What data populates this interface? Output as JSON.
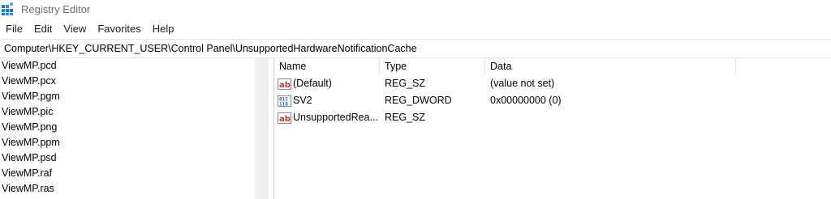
{
  "window": {
    "title": "Registry Editor"
  },
  "menu": [
    "File",
    "Edit",
    "View",
    "Favorites",
    "Help"
  ],
  "address": {
    "path": "Computer\\HKEY_CURRENT_USER\\Control Panel\\UnsupportedHardwareNotificationCache"
  },
  "tree": {
    "items": [
      "ViewMP.pcd",
      "ViewMP.pcx",
      "ViewMP.pgm",
      "ViewMP.pic",
      "ViewMP.png",
      "ViewMP.ppm",
      "ViewMP.psd",
      "ViewMP.raf",
      "ViewMP.ras"
    ]
  },
  "values": {
    "headers": {
      "name": "Name",
      "type": "Type",
      "data": "Data"
    },
    "rows": [
      {
        "icon": "string-value-icon",
        "name": "(Default)",
        "type": "REG_SZ",
        "data": "(value not set)"
      },
      {
        "icon": "binary-value-icon",
        "name": "SV2",
        "type": "REG_DWORD",
        "data": "0x00000000 (0)"
      },
      {
        "icon": "string-value-icon",
        "name": "UnsupportedRea...",
        "type": "REG_SZ",
        "data": ""
      }
    ]
  },
  "colors": {
    "accent": "#1e6fd9",
    "string_icon_red": "#c0392b",
    "binary_icon_blue": "#1f5fbf"
  }
}
